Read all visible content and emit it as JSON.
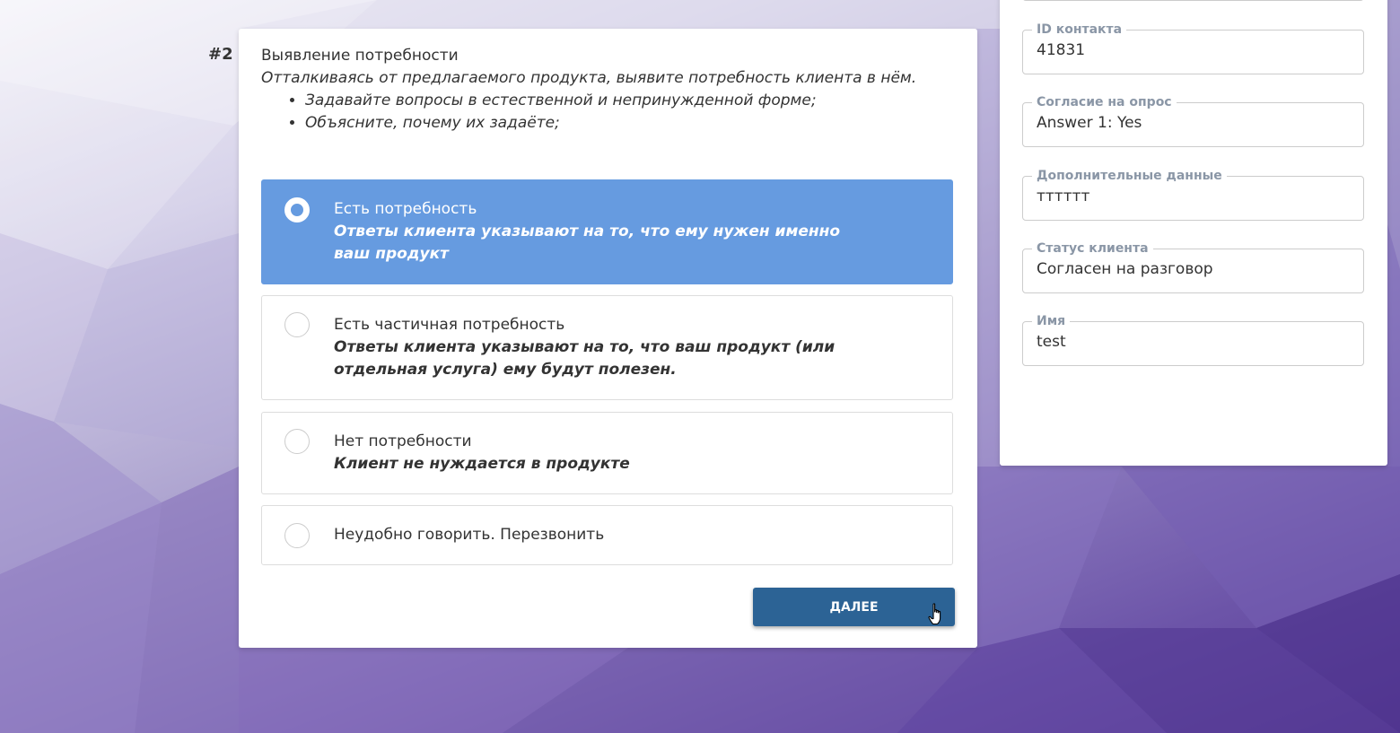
{
  "question": {
    "step_number": "#2",
    "title": "Выявление потребности",
    "description": "Отталкиваясь от предлагаемого продукта, выявите потребность клиента в нём.",
    "hints": [
      "Задавайте вопросы в естественной и непринужденной форме;",
      "Объясните, почему их задаёте;"
    ],
    "options": [
      {
        "label": "Есть потребность",
        "sublabel": "Ответы клиента указывают на то, что ему нужен именно ваш продукт",
        "selected": true
      },
      {
        "label": "Есть частичная потребность",
        "sublabel": "Ответы клиента указывают на то, что ваш продукт (или отдельная услуга) ему будут полезен.",
        "selected": false
      },
      {
        "label": "Нет потребности",
        "sublabel": "Клиент не нуждается в продукте",
        "selected": false
      },
      {
        "label": "Неудобно говорить. Перезвонить",
        "sublabel": "",
        "selected": false
      }
    ],
    "next_button_label": "ДАЛЕЕ"
  },
  "contact_fields": [
    {
      "label": "ID контакта",
      "value": "41831"
    },
    {
      "label": "Согласие на опрос",
      "value": "Answer 1: Yes"
    },
    {
      "label": "Дополнительные данные",
      "value": "тттттт"
    },
    {
      "label": "Статус клиента",
      "value": "Согласен на разговор"
    },
    {
      "label": "Имя",
      "value": "test"
    }
  ],
  "colors": {
    "selected_option": "#669be0",
    "next_button": "#2c6395",
    "field_label": "#8a96a6"
  }
}
